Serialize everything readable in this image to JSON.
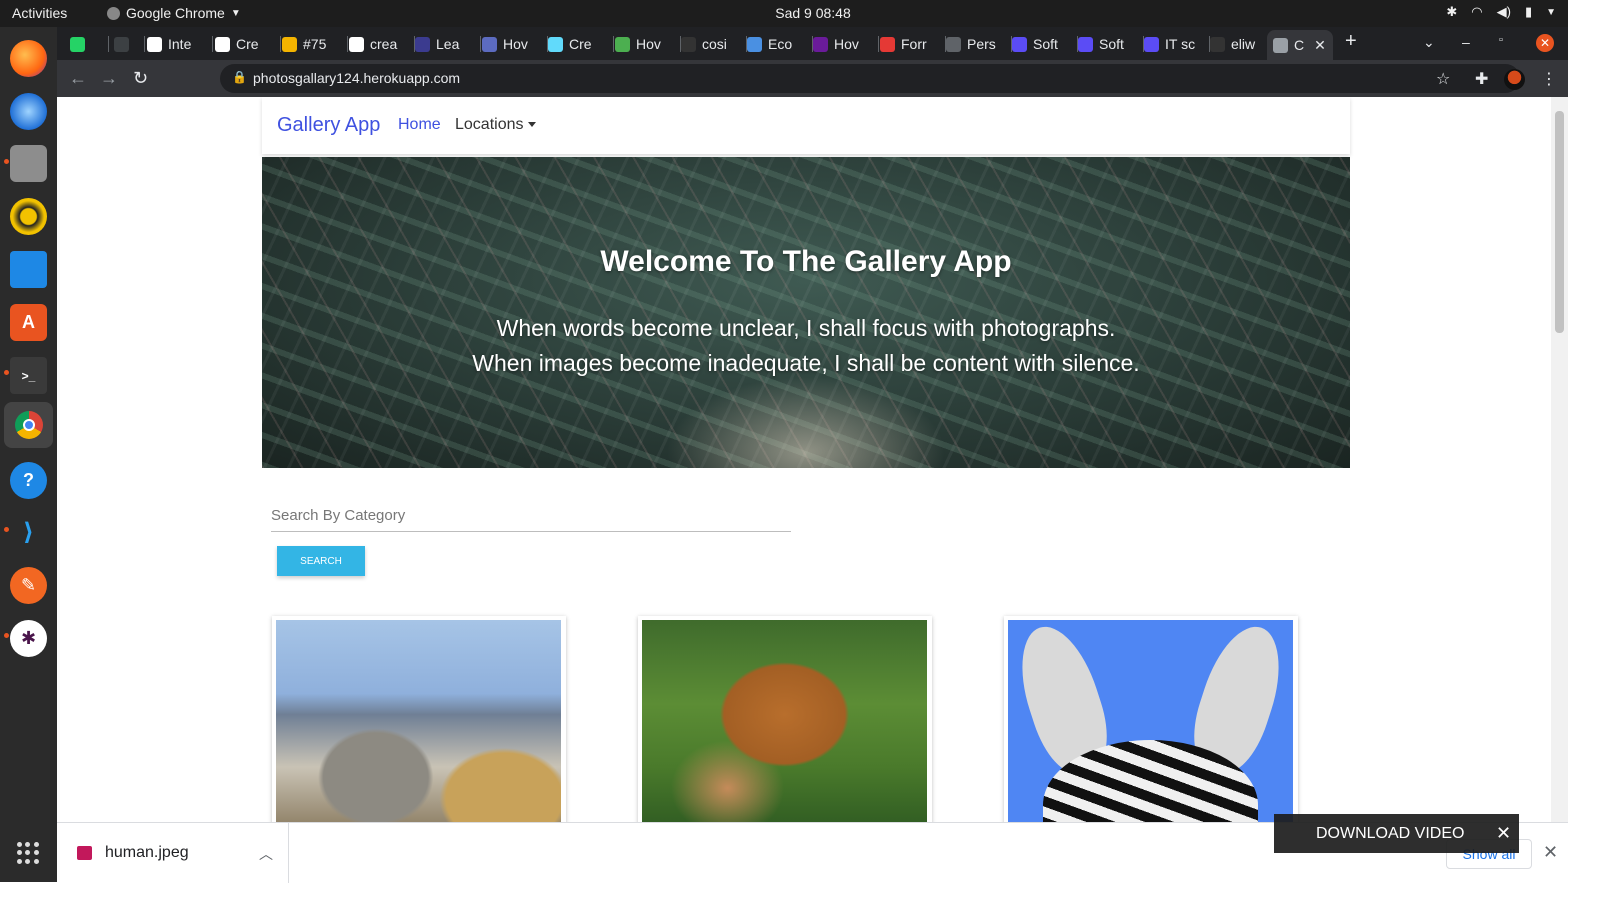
{
  "system": {
    "activities": "Activities",
    "app_menu": "Google Chrome",
    "clock": "Sad 9  08:48"
  },
  "dock": {
    "items": [
      "firefox-icon",
      "thunderbird-icon",
      "files-icon",
      "rhythmbox-icon",
      "writer-icon",
      "software-icon",
      "terminal-icon",
      "chrome-icon",
      "help-icon",
      "vscode-icon",
      "draw-icon",
      "slack-icon"
    ]
  },
  "browser": {
    "tabs": [
      {
        "label": "",
        "color": "#25d366"
      },
      {
        "label": "",
        "color": "#3c4043"
      },
      {
        "label": "Inte",
        "color": "#ffffff"
      },
      {
        "label": "Cre",
        "color": "#ffffff"
      },
      {
        "label": "#75",
        "color": "#f4b400"
      },
      {
        "label": "crea",
        "color": "#ffffff"
      },
      {
        "label": "Lea",
        "color": "#3b3b8f"
      },
      {
        "label": "Hov",
        "color": "#5c6bc0"
      },
      {
        "label": "Cre",
        "color": "#61dafb"
      },
      {
        "label": "Hov",
        "color": "#4caf50"
      },
      {
        "label": "cosi",
        "color": "#333333"
      },
      {
        "label": "Eco",
        "color": "#4a90e2"
      },
      {
        "label": "Hov",
        "color": "#6a1b9a"
      },
      {
        "label": "Forr",
        "color": "#e53935"
      },
      {
        "label": "Pers",
        "color": "#5f6368"
      },
      {
        "label": "Soft",
        "color": "#5b4cf5"
      },
      {
        "label": "Soft",
        "color": "#5b4cf5"
      },
      {
        "label": "IT sc",
        "color": "#5b4cf5"
      },
      {
        "label": "eliw",
        "color": "#333333"
      },
      {
        "label": "C",
        "color": "#9aa0a6"
      }
    ],
    "url": "photosgallary124.herokuapp.com"
  },
  "site": {
    "brand": "Gallery App",
    "nav_home": "Home",
    "nav_locations": "Locations",
    "hero_title": "Welcome To The Gallery App",
    "hero_line1": "When words become unclear, I shall focus with photographs.",
    "hero_line2": "When images become inadequate, I shall be content with silence.",
    "search_placeholder": "Search By Category",
    "search_button": "SEARCH",
    "accent": "#33b5e5",
    "brand_color": "#3f51e0"
  },
  "downloads": {
    "file_name": "human.jpeg",
    "show_all": "Show all",
    "video_label": "DOWNLOAD VIDEO"
  }
}
